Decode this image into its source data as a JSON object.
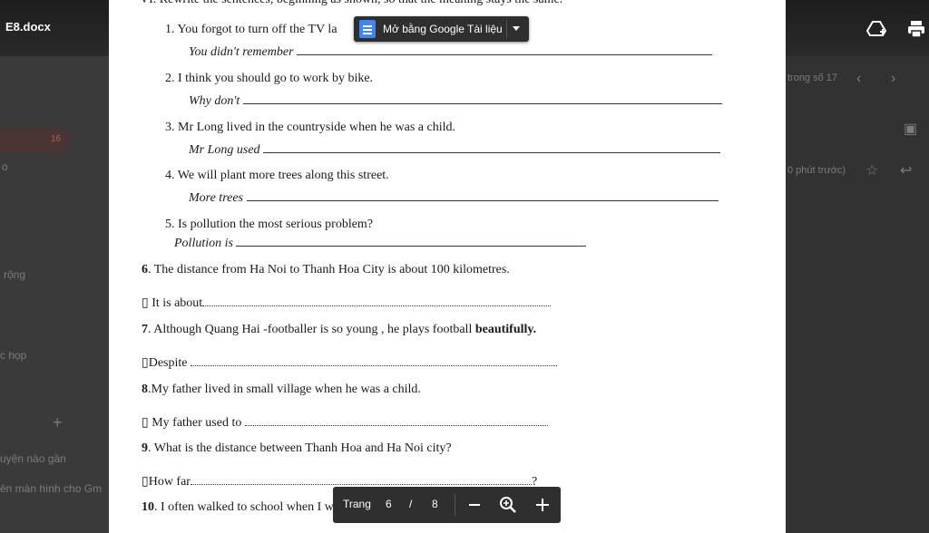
{
  "viewer": {
    "filename": "E8.docx",
    "open_with_label": "Mở bằng Google Tài liệu",
    "page_label": "Trang",
    "current_page": "6",
    "page_sep": "/",
    "total_pages": "8"
  },
  "background": {
    "count_badge": "16",
    "letter_o": "o",
    "rong": "rộng",
    "hop": "c họp",
    "plus": "+",
    "recent": "uyện nào gần",
    "share_screen": "ên màn hình cho Gm",
    "pagination": "trong số 17",
    "time": "0 phút trước)"
  },
  "document": {
    "cut_header": "VI. Rewrite the sentences, beginning as shown, so that the meaning stays the same.",
    "items": [
      {
        "n": "1.",
        "q": "You forgot to turn off the TV la",
        "prompt": "You didn't remember"
      },
      {
        "n": "2.",
        "q": "I think you should go to work by bike.",
        "prompt": "Why don't"
      },
      {
        "n": "3.",
        "q": "Mr Long lived in the countryside when he was a child.",
        "prompt": "Mr Long used"
      },
      {
        "n": "4.",
        "q": "We will plant more trees along this street.",
        "prompt": "More trees"
      },
      {
        "n": "5.",
        "q": "Is pollution the most serious problem?",
        "prompt": "Pollution is"
      }
    ],
    "q6_num": "6",
    "q6": ". The distance from Ha Noi to Thanh Hoa City is about 100 kilometres.",
    "a6": "▯ It is about",
    "q7_num": "7",
    "q7": ". Although Quang Hai -footballer is so young , he plays football ",
    "q7_bold": "beautifully.",
    "a7": "▯Despite",
    "q8_num": "8",
    "q8": ".My father lived in small village when he was a child.",
    "a8": "▯ My father used to",
    "q9_num": "9",
    "q9": ". What is the distance between Thanh Hoa and Ha Noi city?",
    "a9": "▯How far",
    "a9_end": "?",
    "q10_num": "10",
    "q10": ". I often walked to school when I was a student."
  }
}
